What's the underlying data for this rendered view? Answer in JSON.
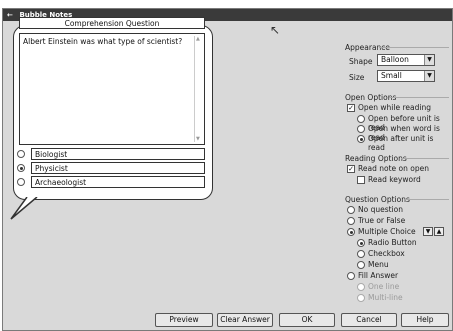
{
  "window": {
    "title": "Bubble Notes"
  },
  "question": {
    "title": "Comprehension Question",
    "text": "Albert Einstein was what type of scientist?",
    "answers": [
      {
        "label": "Biologist",
        "selected": false
      },
      {
        "label": "Physicist",
        "selected": true
      },
      {
        "label": "Archaeologist",
        "selected": false
      }
    ]
  },
  "appearance": {
    "label": "Appearance",
    "shape_label": "Shape",
    "shape_value": "Balloon",
    "size_label": "Size",
    "size_value": "Small"
  },
  "open_options": {
    "label": "Open Options",
    "open_while_reading": "Open while reading",
    "opts": [
      "Open before unit is read",
      "Open when word is read",
      "Open after unit is read"
    ],
    "selected_index": 2
  },
  "reading_options": {
    "label": "Reading Options",
    "read_note": "Read note on open",
    "read_keyword": "Read keyword"
  },
  "question_options": {
    "label": "Question Options",
    "no_question": "No question",
    "true_false": "True or False",
    "multiple_choice": "Multiple Choice",
    "mc_sub": [
      "Radio Button",
      "Checkbox",
      "Menu"
    ],
    "fill_answer": "Fill Answer",
    "fill_sub": [
      "One line",
      "Multi-line"
    ]
  },
  "buttons": {
    "preview": "Preview",
    "clear_answer": "Clear Answer",
    "ok": "OK",
    "cancel": "Cancel",
    "help": "Help"
  }
}
